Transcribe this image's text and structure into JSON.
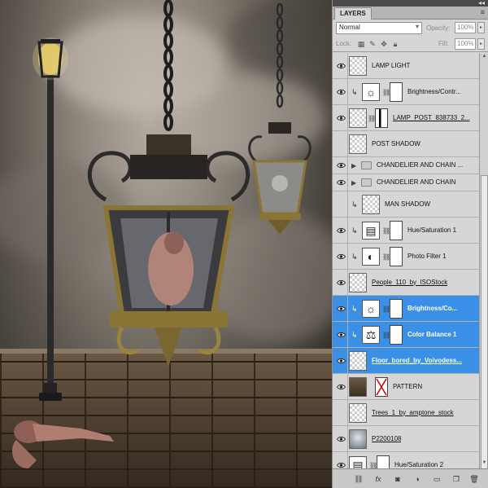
{
  "panel": {
    "tab_label": "LAYERS",
    "blend_mode": "Normal",
    "opacity_label": "Opacity:",
    "opacity_value": "100%",
    "lock_label": "Lock:",
    "fill_label": "Fill:",
    "fill_value": "100%"
  },
  "layers": [
    {
      "name": "LAMP LIGHT",
      "visible": true,
      "kind": "pixel",
      "clipped": false,
      "selected": false
    },
    {
      "name": "Brightness/Contr...",
      "visible": true,
      "kind": "adjustment-brightness",
      "clipped": true,
      "selected": false
    },
    {
      "name": "LAMP_POST_838733_2...",
      "visible": true,
      "kind": "smart-mask",
      "clipped": false,
      "selected": false
    },
    {
      "name": "POST SHADOW",
      "visible": false,
      "kind": "pixel",
      "clipped": false,
      "selected": false
    },
    {
      "name": "CHANDELIER AND CHAIN ...",
      "visible": true,
      "kind": "group",
      "clipped": false,
      "selected": false
    },
    {
      "name": "CHANDELIER AND CHAIN",
      "visible": true,
      "kind": "group",
      "clipped": false,
      "selected": false
    },
    {
      "name": "MAN SHADOW",
      "visible": false,
      "kind": "pixel",
      "clipped": true,
      "selected": false
    },
    {
      "name": "Hue/Saturation 1",
      "visible": true,
      "kind": "adjustment-hue",
      "clipped": true,
      "selected": false
    },
    {
      "name": "Photo Filter 1",
      "visible": true,
      "kind": "adjustment-photo",
      "clipped": true,
      "selected": false
    },
    {
      "name": "People_110_by_ISOStock",
      "visible": true,
      "kind": "pixel",
      "clipped": false,
      "selected": false
    },
    {
      "name": "Brightness/Co...",
      "visible": true,
      "kind": "adjustment-brightness",
      "clipped": true,
      "selected": true
    },
    {
      "name": "Color Balance 1",
      "visible": true,
      "kind": "adjustment-balance",
      "clipped": true,
      "selected": true
    },
    {
      "name": "Floor_bored_by_Voivodess...",
      "visible": true,
      "kind": "pixel",
      "clipped": false,
      "selected": true
    },
    {
      "name": "PATTERN",
      "visible": true,
      "kind": "pattern",
      "clipped": false,
      "selected": false
    },
    {
      "name": "Trees_1_by_amptone_stock",
      "visible": false,
      "kind": "pixel",
      "clipped": false,
      "selected": false
    },
    {
      "name": "P2200108",
      "visible": true,
      "kind": "photo",
      "clipped": false,
      "selected": false
    },
    {
      "name": "Hue/Saturation 2",
      "visible": true,
      "kind": "adjustment-hue",
      "clipped": false,
      "selected": false
    }
  ],
  "bottom_icons": [
    "link-icon",
    "fx-icon",
    "mask-icon",
    "adjustment-icon",
    "folder-icon",
    "new-layer-icon",
    "trash-icon"
  ],
  "colors": {
    "selected": "#3a8fe6",
    "panel_bg": "#d6d6d6"
  }
}
